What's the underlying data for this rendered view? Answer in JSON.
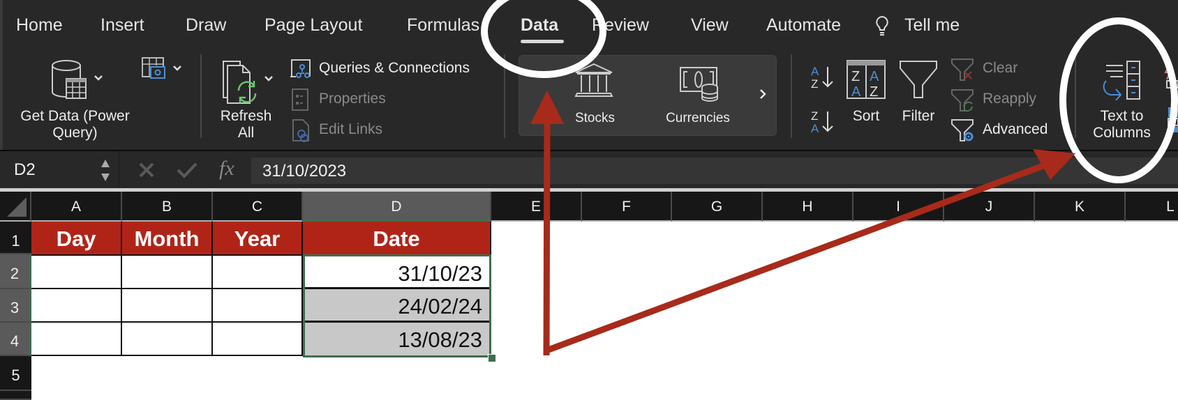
{
  "ribbon": {
    "tabs": [
      {
        "label": "Home"
      },
      {
        "label": "Insert"
      },
      {
        "label": "Draw"
      },
      {
        "label": "Page Layout"
      },
      {
        "label": "Formulas"
      },
      {
        "label": "Data",
        "active": true
      },
      {
        "label": "Review"
      },
      {
        "label": "View"
      },
      {
        "label": "Automate"
      }
    ],
    "tell_me": "Tell me",
    "get_data": {
      "line1": "Get Data (Power",
      "line2": "Query)",
      "icon": "database-table-icon"
    },
    "from_picture_icon": "table-camera-icon",
    "refresh_all": {
      "line1": "Refresh",
      "line2": "All",
      "icon": "refresh-icon"
    },
    "queries_connections": "Queries & Connections",
    "properties": "Properties",
    "edit_links": "Edit Links",
    "data_types": {
      "stocks": "Stocks",
      "currencies": "Currencies"
    },
    "sort_label": "Sort",
    "filter_label": "Filter",
    "clear_label": "Clear",
    "reapply_label": "Reapply",
    "advanced_label": "Advanced",
    "text_to_columns": {
      "line1": "Text to",
      "line2": "Columns"
    }
  },
  "formula_bar": {
    "name_box": "D2",
    "formula_value": "31/10/2023",
    "fx": "fx"
  },
  "sheet": {
    "columns": [
      "A",
      "B",
      "C",
      "D",
      "E",
      "F",
      "G",
      "H",
      "I",
      "J",
      "K",
      "L"
    ],
    "rows": [
      "1",
      "2",
      "3",
      "4",
      "5"
    ],
    "headers": [
      "Day",
      "Month",
      "Year",
      "Date"
    ],
    "dates": [
      "31/10/23",
      "24/02/24",
      "13/08/23"
    ],
    "selected_range": "D2:D4"
  },
  "colors": {
    "header_fill": "#b02418",
    "selection": "#3e6e4e",
    "annotation": "#a82a1a",
    "date_fill_grey": "#c8c8c8"
  }
}
